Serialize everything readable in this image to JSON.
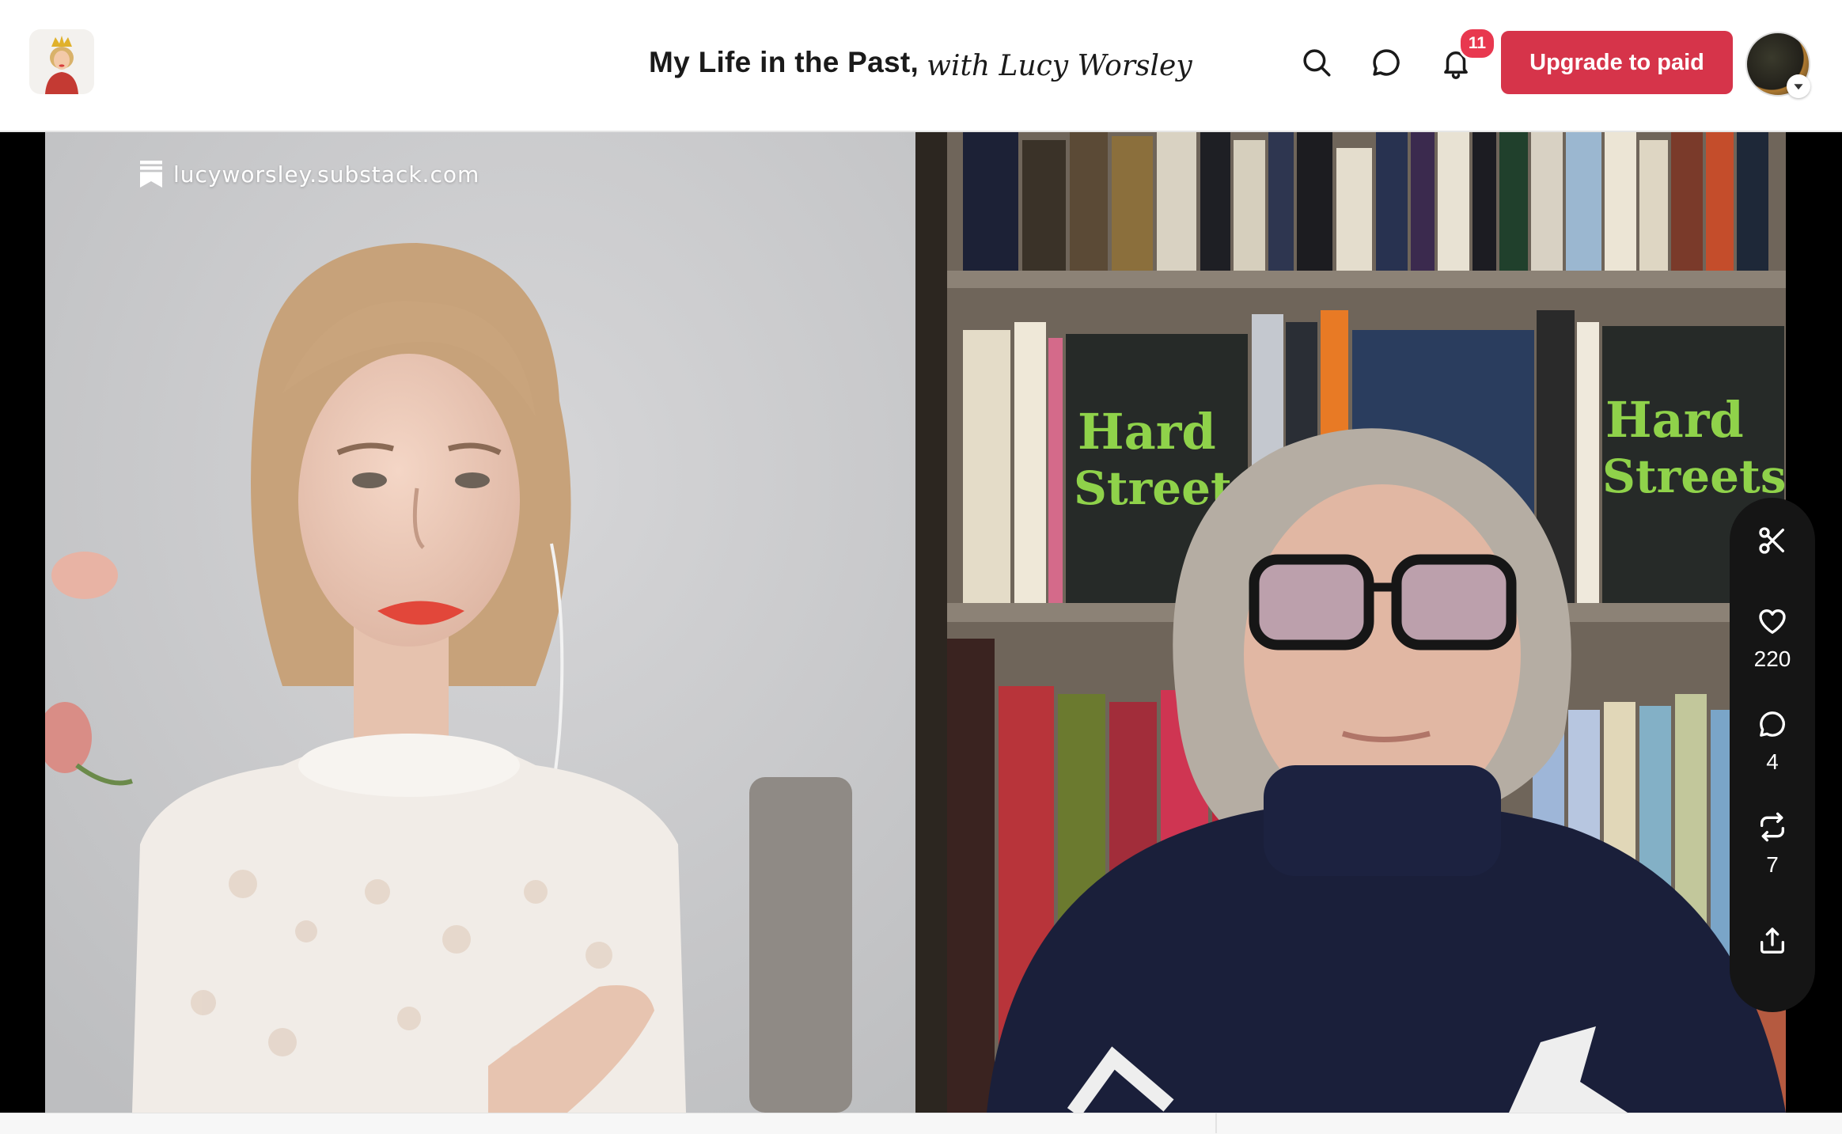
{
  "header": {
    "publication_title": "My Life in the Past,",
    "publication_signature": "with Lucy Worsley",
    "notifications_count": "11",
    "upgrade_label": "Upgrade to paid",
    "icons": [
      "search-icon",
      "chat-icon",
      "bell-icon"
    ]
  },
  "video": {
    "watermark": "lucyworsley.substack.com",
    "watermark_icon": "bookmark-icon",
    "left_pane": "participant-video",
    "right_pane": "participant-video"
  },
  "actions": {
    "clip_icon": "scissors-icon",
    "likes": "220",
    "comments": "4",
    "restacks": "7",
    "share_icon": "share-icon"
  },
  "colors": {
    "accent": "#d6344a",
    "badge": "#e8384f",
    "rail": "#151515"
  }
}
